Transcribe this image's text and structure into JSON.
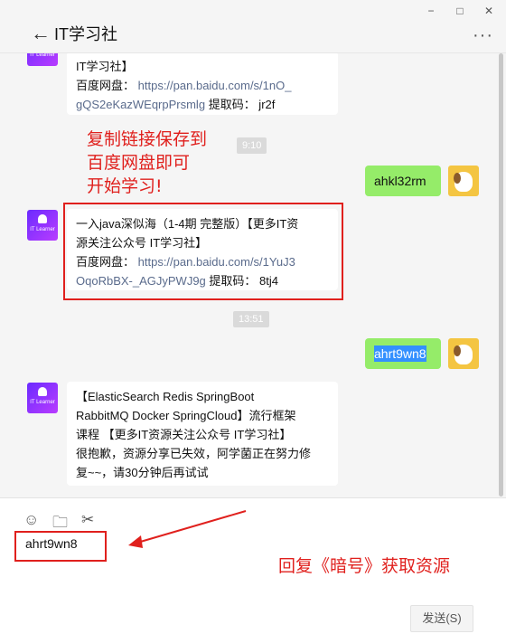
{
  "window": {
    "title": "IT学习社",
    "controls": [
      "−",
      "□",
      "✕"
    ]
  },
  "messages": {
    "m1": {
      "line1": "IT学习社】",
      "line2_label": "百度网盘：",
      "line2_link": "https://pan.baidu.com/s/1nO_",
      "line3_link": "gQS2eKazWEqrpPrsmlg",
      "line3_code": "提取码：  jr2f"
    },
    "time1": "9:10",
    "m2": {
      "text": "ahkl32rm"
    },
    "m3": {
      "line1": "一入java深似海（1-4期 完整版）【更多IT资",
      "line2": "源关注公众号 IT学习社】",
      "line3_label": "百度网盘：",
      "line3_link": "https://pan.baidu.com/s/1YuJ3",
      "line4_link": "OqoRbBX-_AGJyPWJ9g",
      "line4_code": "提取码：  8tj4"
    },
    "time2": "13:51",
    "m4": {
      "text": "ahrt9wn8"
    },
    "m5": {
      "line1": "【ElasticSearch Redis SpringBoot",
      "line2": "RabbitMQ Docker SpringCloud】流行框架",
      "line3": "课程 【更多IT资源关注公众号 IT学习社】",
      "line4": "很抱歉，资源分享已失效，阿学菌正在努力修",
      "line5": "复~~，请30分钟后再试试"
    }
  },
  "avatar_label": "IT Learner",
  "annotations": {
    "copy_line1": "复制链接保存到",
    "copy_line2": "百度网盘即可",
    "copy_line3": "开始学习!",
    "reply": "回复《暗号》获取资源"
  },
  "input": {
    "value": "ahrt9wn8",
    "tools": [
      "emoji-icon",
      "folder-icon",
      "scissors-icon"
    ]
  },
  "send_label": "发送(S)",
  "colors": {
    "annotation_red": "#e0201d",
    "bubble_green": "#95ec69",
    "link": "#5a6b8c"
  }
}
